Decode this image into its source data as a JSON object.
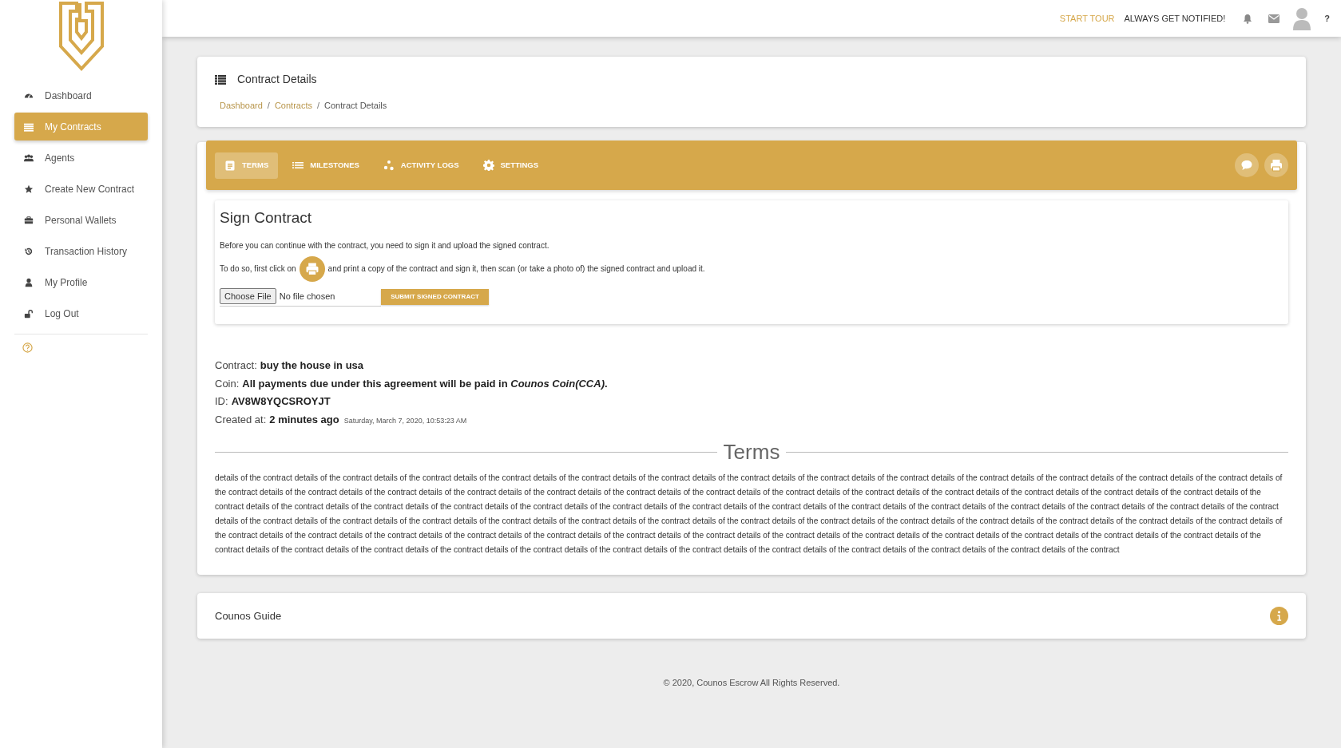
{
  "sidebar": {
    "items": [
      {
        "label": "Dashboard",
        "kind": "gauge",
        "selected": false
      },
      {
        "label": "My Contracts",
        "kind": "list",
        "selected": true
      },
      {
        "label": "Agents",
        "kind": "users",
        "selected": false
      },
      {
        "label": "Create New Contract",
        "kind": "star",
        "selected": false
      },
      {
        "label": "Personal Wallets",
        "kind": "briefcase",
        "selected": false
      },
      {
        "label": "Transaction History",
        "kind": "history",
        "selected": false
      },
      {
        "label": "My Profile",
        "kind": "user",
        "selected": false
      },
      {
        "label": "Log Out",
        "kind": "unlock",
        "selected": false
      }
    ]
  },
  "top_bar": {
    "start_tour": "START TOUR",
    "notify": "ALWAYS GET NOTIFIED!",
    "help": "?"
  },
  "page_header": {
    "title": "Contract Details",
    "separator": "/",
    "breadcrumb": [
      {
        "label": "Dashboard",
        "current": false
      },
      {
        "label": "Contracts",
        "current": false
      },
      {
        "label": "Contract Details",
        "current": true
      }
    ]
  },
  "tabs": [
    {
      "label": "TERMS",
      "kind": "clipboard",
      "selected": true
    },
    {
      "label": "MILESTONES",
      "kind": "list",
      "selected": false
    },
    {
      "label": "ACTIVITY LOGS",
      "kind": "dots",
      "selected": false
    },
    {
      "label": "SETTINGS",
      "kind": "gear",
      "selected": false
    }
  ],
  "sign_contract": {
    "title": "Sign Contract",
    "intro": "Before you can continue with the contract, you need to sign it and upload the signed contract.",
    "instruction_before": "To do so, first click on",
    "instruction_after": "and print a copy of the contract and sign it, then scan (or take a photo of) the signed contract and upload it.",
    "file_button": "Choose File",
    "file_status": "No file chosen",
    "submit": "SUBMIT SIGNED CONTRACT"
  },
  "contract_info": [
    {
      "label": "Contract:",
      "value": "buy the house in usa"
    },
    {
      "label": "Coin:",
      "value": "All payments due under this agreement will be paid in *Counos Coin(CCA)*."
    },
    {
      "label": "ID:",
      "value": "AV8W8YQCSROYJT"
    },
    {
      "label": "Created at:",
      "value": "2 minutes ago",
      "note": "Saturday, March 7, 2020, 10:53:23 AM"
    }
  ],
  "terms": {
    "heading": "Terms",
    "text": "details of the contract details of the contract details of the contract details of the contract details of the contract details of the contract details of the contract details of the contract details of the contract details of the contract details of the contract details of the contract details of the contract details of the contract details of the contract details of the contract details of the contract details of the contract details of the contract details of the contract details of the contract details of the contract details of the contract details of the contract details of the contract details of the contract details of the contract details of the contract details of the contract details of the contract details of the contract details of the contract details of the contract details of the contract details of the contract details of the contract details of the contract details of the contract details of the contract details of the contract details of the contract details of the contract details of the contract details of the contract details of the contract details of the contract details of the contract details of the contract details of the contract details of the contract details of the contract details of the contract details of the contract details of the contract details of the contract details of the contract details of the contract details of the contract details of the contract details of the contract details of the contract details of the contract details of the contract details of the contract details of the contract details of the contract details of the contract details of the contract details of the contract details of the contract details of the contract details of the contract details of the contract details of the contract details of the contract details of the contract details of the contract details of the contract"
  },
  "guide": {
    "title": "Counos Guide"
  },
  "footer": "© 2020, Counos Escrow All Rights Reserved."
}
